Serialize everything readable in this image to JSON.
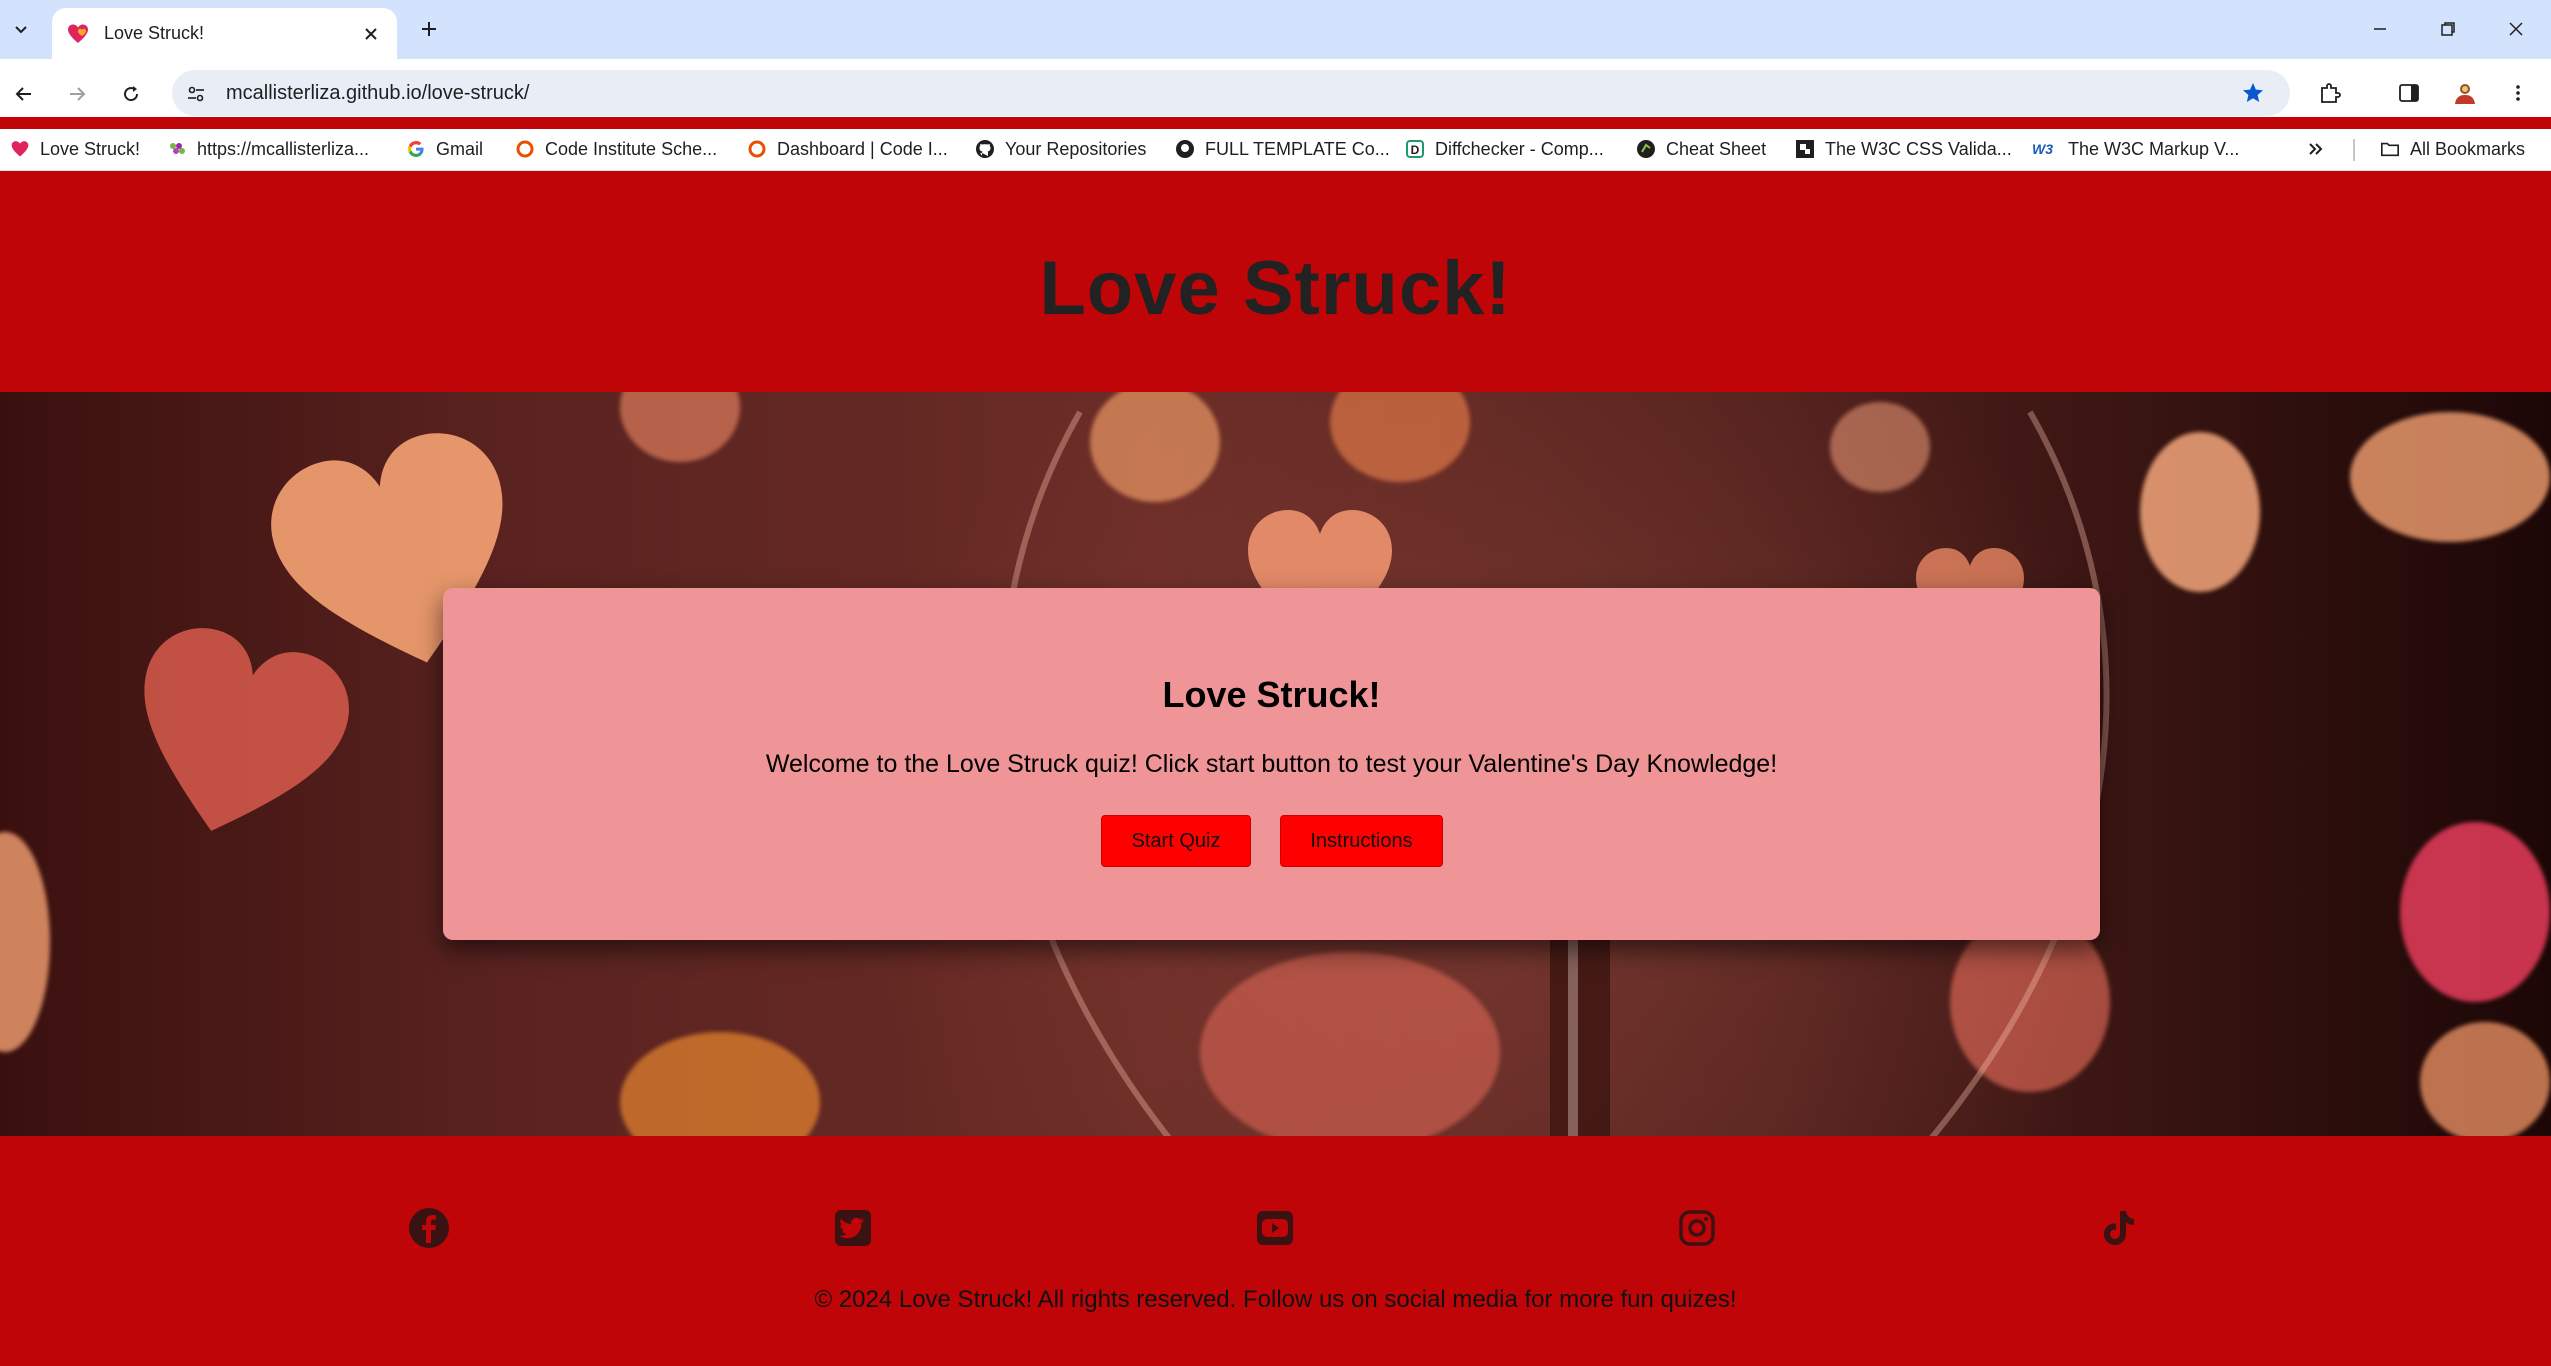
{
  "browser": {
    "tab_title": "Love Struck!",
    "url": "mcallisterliza.github.io/love-struck/",
    "bookmarks": [
      {
        "label": "Love Struck!",
        "icon": "heart-favicon-icon"
      },
      {
        "label": "https://mcallisterliza...",
        "icon": "grapes-favicon-icon"
      },
      {
        "label": "Gmail",
        "icon": "google-icon"
      },
      {
        "label": "Code Institute Sche...",
        "icon": "code-institute-icon"
      },
      {
        "label": "Dashboard | Code I...",
        "icon": "code-institute-icon"
      },
      {
        "label": "Your Repositories",
        "icon": "github-icon"
      },
      {
        "label": "FULL TEMPLATE Co...",
        "icon": "github-icon"
      },
      {
        "label": "Diffchecker - Comp...",
        "icon": "diffchecker-icon"
      },
      {
        "label": "Cheat Sheet",
        "icon": "cheat-sheet-icon"
      },
      {
        "label": "The W3C CSS Valida...",
        "icon": "w3c-css-icon"
      },
      {
        "label": "The W3C Markup V...",
        "icon": "w3c-icon"
      }
    ],
    "all_bookmarks_label": "All Bookmarks"
  },
  "page": {
    "header_title": "Love Struck!",
    "card": {
      "title": "Love Struck!",
      "text": "Welcome to the Love Struck quiz! Click start button to test your Valentine's Day Knowledge!",
      "start_button": "Start Quiz",
      "instructions_button": "Instructions"
    },
    "social_icons": [
      "facebook-icon",
      "twitter-icon",
      "youtube-icon",
      "instagram-icon",
      "tiktok-icon"
    ],
    "footer_text": "© 2024 Love Struck! All rights reserved. Follow us on social media for more fun quizes!"
  },
  "colors": {
    "header_bg": "#bf0508",
    "card_bg": "#ef9597",
    "button_bg": "#ff0000",
    "browser_tabstrip": "#d3e3fd"
  }
}
